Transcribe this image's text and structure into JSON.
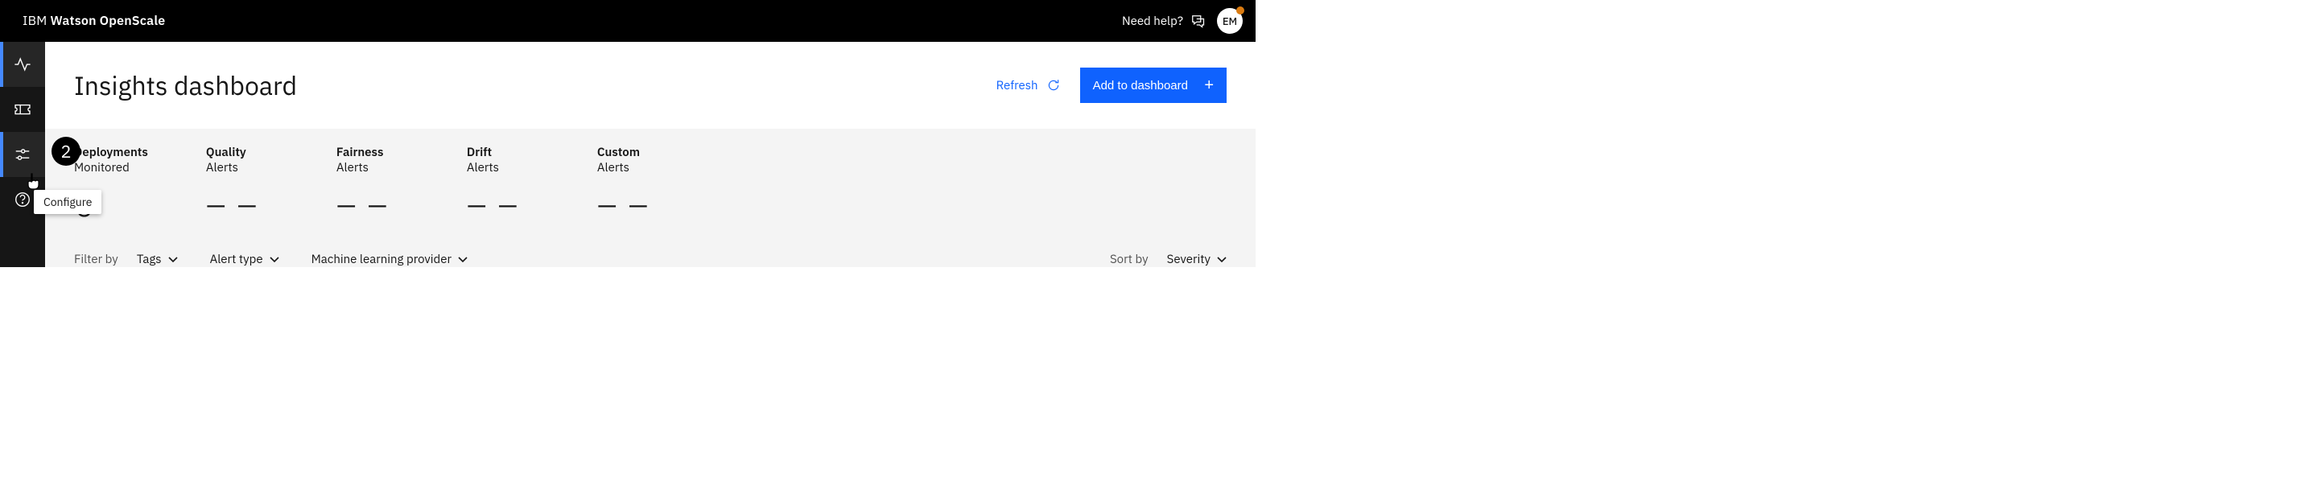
{
  "header": {
    "brand_prefix": "IBM",
    "brand_main": "Watson OpenScale",
    "need_help": "Need help?",
    "avatar_initials": "EM"
  },
  "nav": {
    "tooltip": "Configure"
  },
  "step_badge": "2",
  "page": {
    "title": "Insights dashboard",
    "refresh_label": "Refresh",
    "add_label": "Add to dashboard"
  },
  "metrics": [
    {
      "line1": "Deployments",
      "line2": "Monitored",
      "value": "0"
    },
    {
      "line1": "Quality",
      "line2": "Alerts",
      "value": "– –"
    },
    {
      "line1": "Fairness",
      "line2": "Alerts",
      "value": "– –"
    },
    {
      "line1": "Drift",
      "line2": "Alerts",
      "value": "– –"
    },
    {
      "line1": "Custom",
      "line2": "Alerts",
      "value": "– –"
    }
  ],
  "filters": {
    "filter_by": "Filter by",
    "tags": "Tags",
    "alert_type": "Alert type",
    "provider": "Machine learning provider",
    "sort_by": "Sort by",
    "severity": "Severity"
  }
}
